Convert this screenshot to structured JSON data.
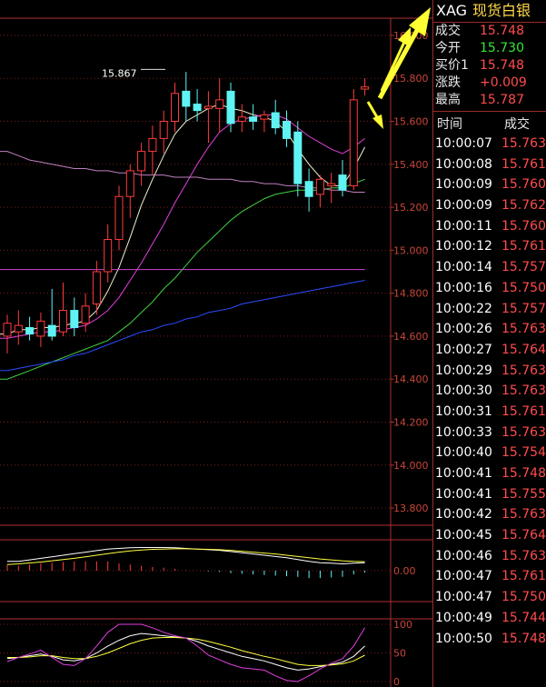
{
  "quote": {
    "symbol": "XAG",
    "name": "现货白银",
    "rows": [
      {
        "label": "成交",
        "value": "15.748",
        "color": "red"
      },
      {
        "label": "今开",
        "value": "15.730",
        "color": "green"
      },
      {
        "label": "买价1",
        "value": "15.748",
        "color": "red"
      },
      {
        "label": "涨跌",
        "value": "+0.009",
        "color": "red"
      },
      {
        "label": "最高",
        "value": "15.787",
        "color": "red"
      }
    ],
    "time_header": "时间",
    "price_header": "成交"
  },
  "ticks": [
    {
      "time": "10:00:07",
      "price": "15.763"
    },
    {
      "time": "10:00:08",
      "price": "15.761"
    },
    {
      "time": "10:00:09",
      "price": "15.760"
    },
    {
      "time": "10:00:09",
      "price": "15.762"
    },
    {
      "time": "10:00:11",
      "price": "15.760"
    },
    {
      "time": "10:00:12",
      "price": "15.761"
    },
    {
      "time": "10:00:14",
      "price": "15.757"
    },
    {
      "time": "10:00:16",
      "price": "15.750"
    },
    {
      "time": "10:00:22",
      "price": "15.757"
    },
    {
      "time": "10:00:26",
      "price": "15.763"
    },
    {
      "time": "10:00:27",
      "price": "15.764"
    },
    {
      "time": "10:00:29",
      "price": "15.763"
    },
    {
      "time": "10:00:30",
      "price": "15.763"
    },
    {
      "time": "10:00:31",
      "price": "15.761"
    },
    {
      "time": "10:00:33",
      "price": "15.763"
    },
    {
      "time": "10:00:40",
      "price": "15.754"
    },
    {
      "time": "10:00:41",
      "price": "15.748"
    },
    {
      "time": "10:00:41",
      "price": "15.755"
    },
    {
      "time": "10:00:42",
      "price": "15.763"
    },
    {
      "time": "10:00:45",
      "price": "15.764"
    },
    {
      "time": "10:00:46",
      "price": "15.763"
    },
    {
      "time": "10:00:47",
      "price": "15.761"
    },
    {
      "time": "10:00:47",
      "price": "15.750"
    },
    {
      "time": "10:00:49",
      "price": "15.744"
    },
    {
      "time": "10:00:50",
      "price": "15.748"
    }
  ],
  "chart_data": [
    {
      "type": "candlestick",
      "ylim": [
        13.72,
        16.08
      ],
      "y_ticks": [
        "16.000",
        "15.800",
        "15.600",
        "15.400",
        "15.200",
        "15.000",
        "14.800",
        "14.600",
        "14.400",
        "14.200",
        "14.000",
        "13.800"
      ],
      "annotation": {
        "text": "15.867",
        "value": 15.867
      },
      "grid": true,
      "candles": [
        {
          "o": 14.6,
          "h": 14.7,
          "l": 14.52,
          "c": 14.66
        },
        {
          "o": 14.62,
          "h": 14.72,
          "l": 14.56,
          "c": 14.65
        },
        {
          "o": 14.64,
          "h": 14.69,
          "l": 14.58,
          "c": 14.61
        },
        {
          "o": 14.6,
          "h": 14.71,
          "l": 14.55,
          "c": 14.67
        },
        {
          "o": 14.65,
          "h": 14.82,
          "l": 14.58,
          "c": 14.6
        },
        {
          "o": 14.62,
          "h": 14.85,
          "l": 14.6,
          "c": 14.72
        },
        {
          "o": 14.72,
          "h": 14.78,
          "l": 14.6,
          "c": 14.64
        },
        {
          "o": 14.66,
          "h": 14.8,
          "l": 14.62,
          "c": 14.74
        },
        {
          "o": 14.75,
          "h": 14.95,
          "l": 14.7,
          "c": 14.9
        },
        {
          "o": 14.9,
          "h": 15.12,
          "l": 14.85,
          "c": 15.05
        },
        {
          "o": 15.05,
          "h": 15.3,
          "l": 15.0,
          "c": 15.25
        },
        {
          "o": 15.25,
          "h": 15.4,
          "l": 15.15,
          "c": 15.37
        },
        {
          "o": 15.37,
          "h": 15.5,
          "l": 15.3,
          "c": 15.46
        },
        {
          "o": 15.46,
          "h": 15.58,
          "l": 15.35,
          "c": 15.52
        },
        {
          "o": 15.52,
          "h": 15.65,
          "l": 15.45,
          "c": 15.6
        },
        {
          "o": 15.6,
          "h": 15.78,
          "l": 15.55,
          "c": 15.73
        },
        {
          "o": 15.74,
          "h": 15.83,
          "l": 15.6,
          "c": 15.67
        },
        {
          "o": 15.68,
          "h": 15.75,
          "l": 15.6,
          "c": 15.65
        },
        {
          "o": 15.66,
          "h": 15.74,
          "l": 15.5,
          "c": 15.67
        },
        {
          "o": 15.66,
          "h": 15.8,
          "l": 15.55,
          "c": 15.7
        },
        {
          "o": 15.74,
          "h": 15.78,
          "l": 15.55,
          "c": 15.59
        },
        {
          "o": 15.6,
          "h": 15.68,
          "l": 15.55,
          "c": 15.62
        },
        {
          "o": 15.62,
          "h": 15.68,
          "l": 15.56,
          "c": 15.6
        },
        {
          "o": 15.61,
          "h": 15.65,
          "l": 15.55,
          "c": 15.63
        },
        {
          "o": 15.64,
          "h": 15.7,
          "l": 15.54,
          "c": 15.57
        },
        {
          "o": 15.6,
          "h": 15.65,
          "l": 15.48,
          "c": 15.52
        },
        {
          "o": 15.55,
          "h": 15.6,
          "l": 15.25,
          "c": 15.31
        },
        {
          "o": 15.32,
          "h": 15.38,
          "l": 15.18,
          "c": 15.25
        },
        {
          "o": 15.26,
          "h": 15.35,
          "l": 15.2,
          "c": 15.33
        },
        {
          "o": 15.3,
          "h": 15.36,
          "l": 15.22,
          "c": 15.31
        },
        {
          "o": 15.35,
          "h": 15.42,
          "l": 15.25,
          "c": 15.28
        },
        {
          "o": 15.3,
          "h": 15.75,
          "l": 15.28,
          "c": 15.7
        },
        {
          "o": 15.75,
          "h": 15.8,
          "l": 15.72,
          "c": 15.76
        }
      ],
      "ma": [
        {
          "name": "MA5",
          "color": "#f0f0d0",
          "values": [
            14.61,
            14.63,
            14.63,
            14.64,
            14.64,
            14.65,
            14.66,
            14.67,
            14.72,
            14.81,
            14.92,
            15.06,
            15.21,
            15.33,
            15.44,
            15.54,
            15.6,
            15.63,
            15.66,
            15.68,
            15.66,
            15.65,
            15.63,
            15.62,
            15.6,
            15.55,
            15.47,
            15.4,
            15.34,
            15.3,
            15.3,
            15.38,
            15.48
          ]
        },
        {
          "name": "MA10",
          "color": "#e040e0",
          "values": [
            14.59,
            14.6,
            14.61,
            14.62,
            14.62,
            14.63,
            14.64,
            14.65,
            14.68,
            14.72,
            14.78,
            14.86,
            14.94,
            15.03,
            15.12,
            15.22,
            15.31,
            15.4,
            15.48,
            15.55,
            15.59,
            15.61,
            15.62,
            15.63,
            15.63,
            15.61,
            15.57,
            15.53,
            15.5,
            15.47,
            15.45,
            15.48,
            15.52
          ]
        },
        {
          "name": "MA20",
          "color": "#40d040",
          "values": [
            14.4,
            14.42,
            14.44,
            14.46,
            14.48,
            14.5,
            14.52,
            14.54,
            14.56,
            14.58,
            14.62,
            14.66,
            14.71,
            14.76,
            14.82,
            14.87,
            14.93,
            14.99,
            15.04,
            15.09,
            15.14,
            15.18,
            15.21,
            15.24,
            15.26,
            15.27,
            15.28,
            15.28,
            15.28,
            15.29,
            15.29,
            15.31,
            15.33
          ]
        },
        {
          "name": "MA60",
          "color": "#2b4cff",
          "values": [
            14.44,
            14.45,
            14.46,
            14.47,
            14.48,
            14.49,
            14.51,
            14.52,
            14.54,
            14.56,
            14.58,
            14.6,
            14.62,
            14.63,
            14.65,
            14.66,
            14.68,
            14.69,
            14.71,
            14.72,
            14.73,
            14.75,
            14.76,
            14.77,
            14.78,
            14.79,
            14.8,
            14.81,
            14.82,
            14.83,
            14.84,
            14.85,
            14.86
          ]
        },
        {
          "name": "MA120",
          "color": "#c080c0",
          "values": [
            15.46,
            15.44,
            15.42,
            15.41,
            15.4,
            15.39,
            15.38,
            15.38,
            15.37,
            15.37,
            15.36,
            15.36,
            15.35,
            15.35,
            15.35,
            15.34,
            15.34,
            15.34,
            15.33,
            15.33,
            15.33,
            15.32,
            15.32,
            15.31,
            15.31,
            15.3,
            15.3,
            15.29,
            15.29,
            15.28,
            15.28,
            15.27,
            15.27
          ]
        },
        {
          "name": "MA250",
          "color": "#cc44cc",
          "values": [
            14.91,
            14.91,
            14.91,
            14.91,
            14.91,
            14.91,
            14.91,
            14.91,
            14.91,
            14.91,
            14.91,
            14.91,
            14.91,
            14.91,
            14.91,
            14.91,
            14.91,
            14.91,
            14.91,
            14.91,
            14.91,
            14.91,
            14.91,
            14.91,
            14.91,
            14.91,
            14.91,
            14.91,
            14.91,
            14.91,
            14.91,
            14.91,
            14.91
          ]
        }
      ]
    },
    {
      "type": "macd",
      "ylim": [
        -0.1,
        0.1
      ],
      "y_ticks": [
        "0.00"
      ],
      "dif": [
        0.03,
        0.03,
        0.035,
        0.04,
        0.045,
        0.05,
        0.055,
        0.06,
        0.065,
        0.07,
        0.072,
        0.074,
        0.075,
        0.075,
        0.075,
        0.074,
        0.072,
        0.07,
        0.068,
        0.066,
        0.062,
        0.058,
        0.054,
        0.05,
        0.046,
        0.042,
        0.036,
        0.03,
        0.026,
        0.024,
        0.022,
        0.024,
        0.026
      ],
      "dea": [
        0.02,
        0.022,
        0.025,
        0.028,
        0.032,
        0.036,
        0.04,
        0.045,
        0.05,
        0.055,
        0.06,
        0.064,
        0.067,
        0.069,
        0.07,
        0.071,
        0.071,
        0.07,
        0.069,
        0.068,
        0.066,
        0.063,
        0.06,
        0.057,
        0.054,
        0.05,
        0.046,
        0.042,
        0.038,
        0.035,
        0.032,
        0.03,
        0.029
      ],
      "hist": [
        0.02,
        0.016,
        0.02,
        0.024,
        0.026,
        0.028,
        0.03,
        0.03,
        0.03,
        0.03,
        0.024,
        0.02,
        0.016,
        0.012,
        0.01,
        0.006,
        0.002,
        0.0,
        -0.002,
        -0.004,
        -0.008,
        -0.01,
        -0.012,
        -0.014,
        -0.016,
        -0.018,
        -0.02,
        -0.024,
        -0.024,
        -0.022,
        -0.02,
        -0.012,
        -0.006
      ]
    },
    {
      "type": "kdj",
      "ylim": [
        0,
        100
      ],
      "y_ticks": [
        "100",
        "50",
        "0"
      ],
      "k": [
        40,
        42,
        45,
        48,
        44,
        38,
        36,
        40,
        50,
        62,
        72,
        80,
        84,
        82,
        80,
        78,
        76,
        70,
        62,
        56,
        50,
        44,
        40,
        36,
        30,
        24,
        20,
        22,
        26,
        30,
        34,
        44,
        62
      ],
      "d": [
        42,
        42,
        43,
        45,
        45,
        42,
        40,
        40,
        44,
        50,
        58,
        66,
        72,
        76,
        77,
        77,
        76,
        74,
        70,
        65,
        60,
        54,
        49,
        44,
        40,
        35,
        30,
        28,
        28,
        29,
        31,
        36,
        46
      ],
      "j": [
        35,
        42,
        48,
        55,
        42,
        30,
        28,
        40,
        62,
        86,
        100,
        102,
        100,
        94,
        86,
        80,
        76,
        62,
        46,
        38,
        30,
        24,
        22,
        20,
        10,
        2,
        0,
        10,
        22,
        32,
        40,
        62,
        94
      ]
    }
  ]
}
